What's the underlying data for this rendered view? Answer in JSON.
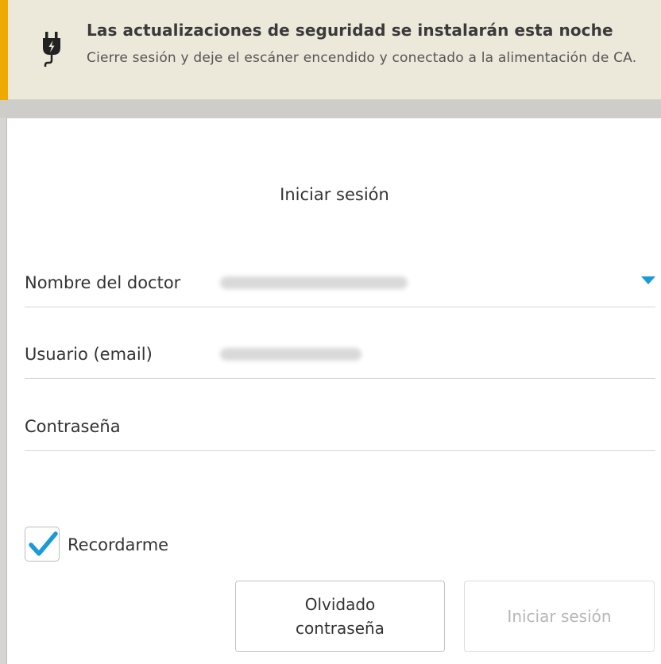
{
  "banner": {
    "title": "Las actualizaciones de seguridad se instalarán esta noche",
    "message": "Cierre sesión y deje el escáner encendido y conectado a la alimentación de CA.",
    "icon": "power-plug-icon",
    "accent_color": "#eeaa00"
  },
  "login": {
    "title": "Iniciar sesión",
    "doctor_label": "Nombre del doctor",
    "doctor_value": "",
    "user_label": "Usuario (email)",
    "user_value": "",
    "password_label": "Contraseña",
    "remember_label": "Recordarme",
    "remember_checked": true,
    "forgot_button": "Olvidado contraseña",
    "login_button": "Iniciar sesión"
  },
  "colors": {
    "check": "#1a9bd7",
    "dropdown_arrow": "#1a9bd7"
  }
}
